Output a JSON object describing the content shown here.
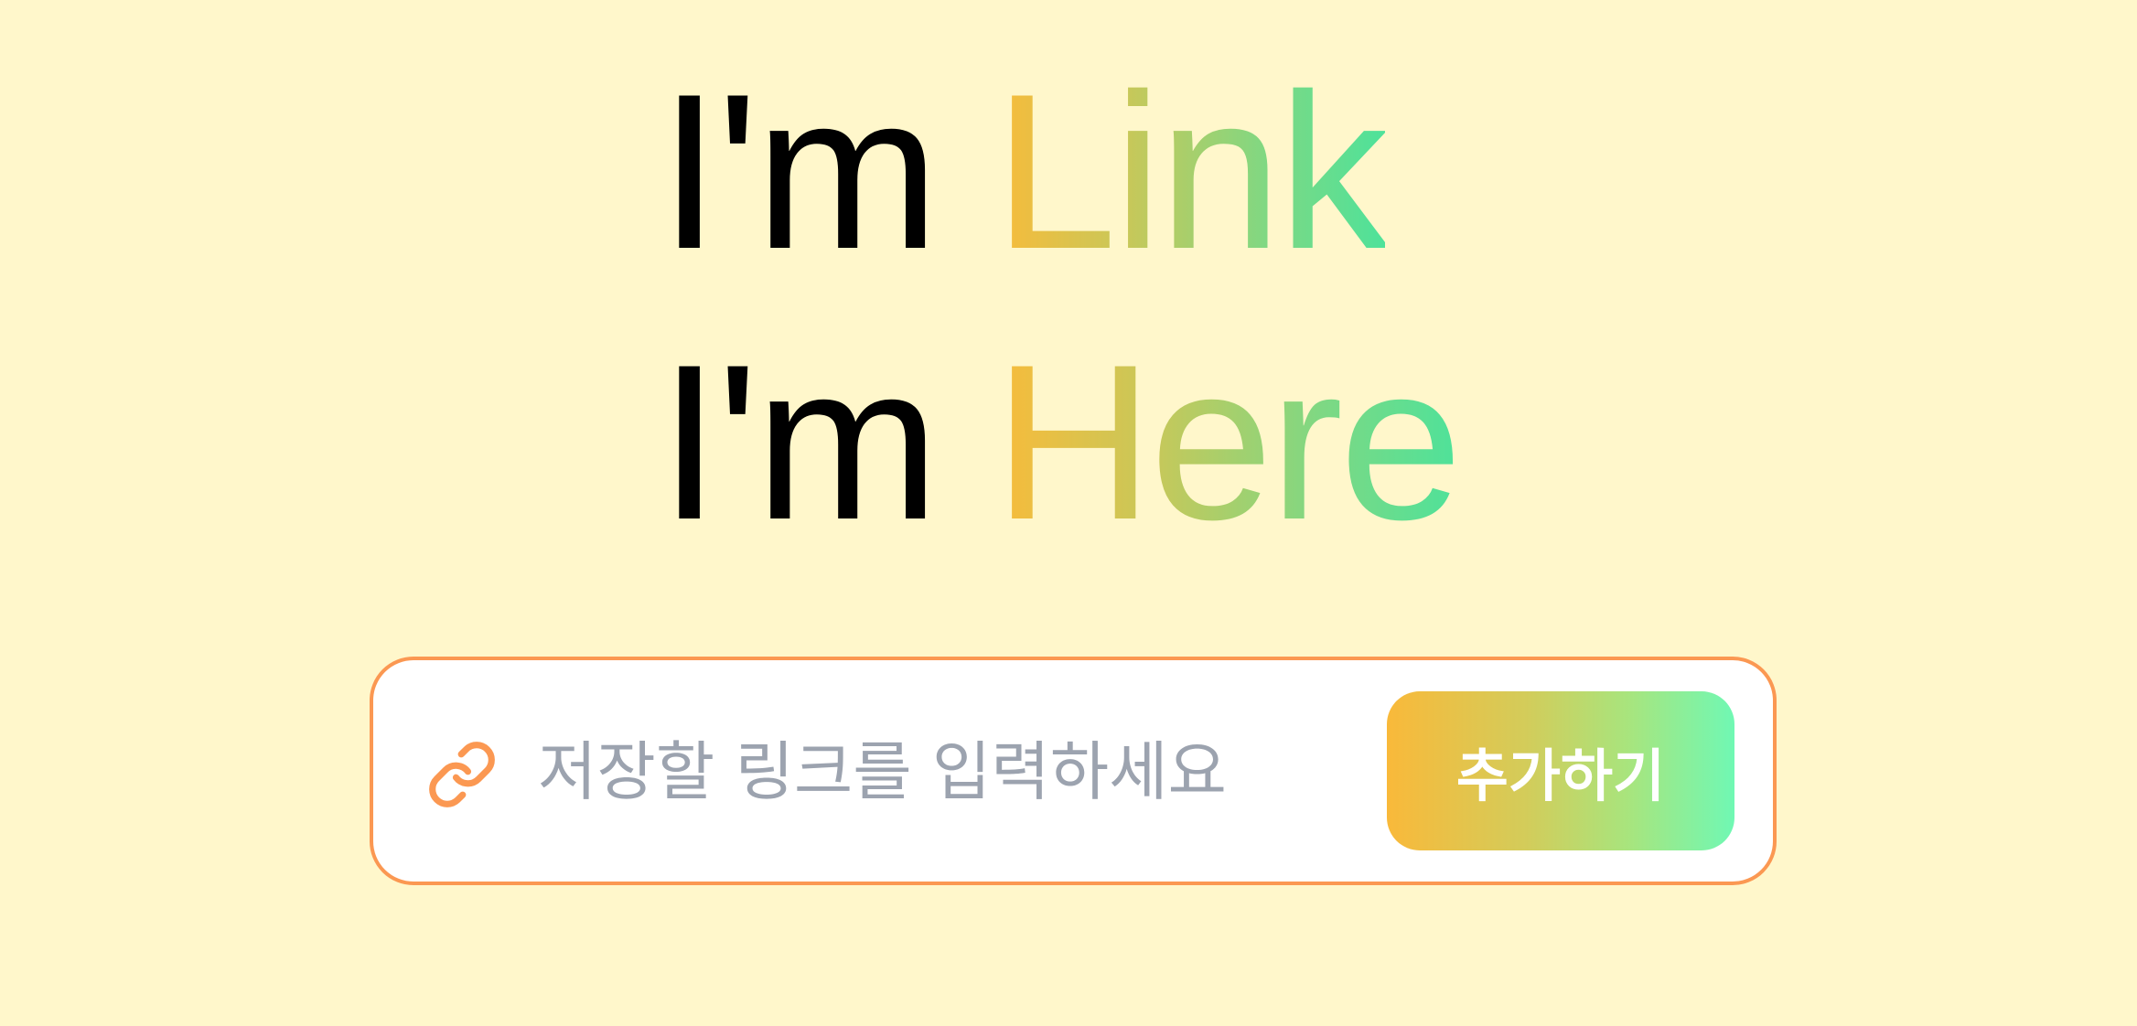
{
  "hero": {
    "line1": {
      "prefix": "I'm ",
      "highlight": "Link"
    },
    "line2": {
      "prefix": "I'm ",
      "highlight": "Here"
    }
  },
  "form": {
    "input_placeholder": "저장할 링크를 입력하세요",
    "input_value": "",
    "link_icon": "link-chain-icon",
    "add_button_label": "추가하기"
  },
  "colors": {
    "background": "#fff7cb",
    "border": "#fb9852",
    "icon": "#fb9852",
    "gradient_start": "#f9bb3a",
    "gradient_end": "#4ee29a",
    "button_gradient_end": "#70f8b4",
    "placeholder": "#9ca3af"
  }
}
